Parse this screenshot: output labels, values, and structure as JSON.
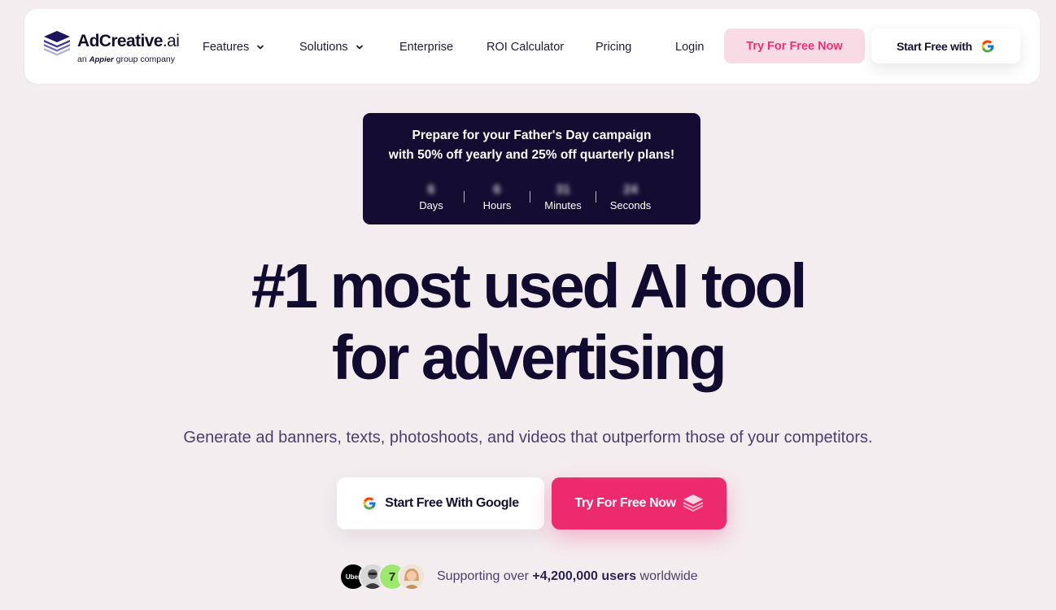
{
  "nav": {
    "logo_word_main": "AdCreative",
    "logo_word_suffix": ".ai",
    "logo_sub_pre": "an",
    "logo_sub_brand": "Appier",
    "logo_sub_post": "group company",
    "items": [
      {
        "label": "Features",
        "has_dropdown": true
      },
      {
        "label": "Solutions",
        "has_dropdown": true
      },
      {
        "label": "Enterprise",
        "has_dropdown": false
      },
      {
        "label": "ROI Calculator",
        "has_dropdown": false
      },
      {
        "label": "Pricing",
        "has_dropdown": false
      },
      {
        "label": "Login",
        "has_dropdown": false
      }
    ],
    "try_button": "Try For Free Now",
    "google_button": "Start Free with"
  },
  "promo": {
    "line1": "Prepare for your Father's Day campaign",
    "line2": "with 50% off yearly and 25% off quarterly plans!",
    "countdown": [
      {
        "value": "6",
        "label": "Days"
      },
      {
        "value": "6",
        "label": "Hours"
      },
      {
        "value": "31",
        "label": "Minutes"
      },
      {
        "value": "24",
        "label": "Seconds"
      }
    ]
  },
  "hero": {
    "title_line1": "#1 most used AI tool",
    "title_line2": "for advertising",
    "subtitle": "Generate ad banners, texts, photoshoots, and videos that outperform those of your competitors.",
    "cta_google": "Start Free With Google",
    "cta_try": "Try For Free Now"
  },
  "social": {
    "uber_label": "Uber",
    "wise_label": "7",
    "text_pre": "Supporting over",
    "text_bold": "+4,200,000 users",
    "text_post": "worldwide"
  },
  "colors": {
    "background": "#f4edf0",
    "primary_pink": "#ee2a6f",
    "pink_soft": "#f9dbe6",
    "dark_navy": "#140c31",
    "text_muted": "#4a3f6b"
  },
  "icons": [
    "layers-logo-icon",
    "chevron-down-icon",
    "google-icon",
    "stack-icon"
  ]
}
